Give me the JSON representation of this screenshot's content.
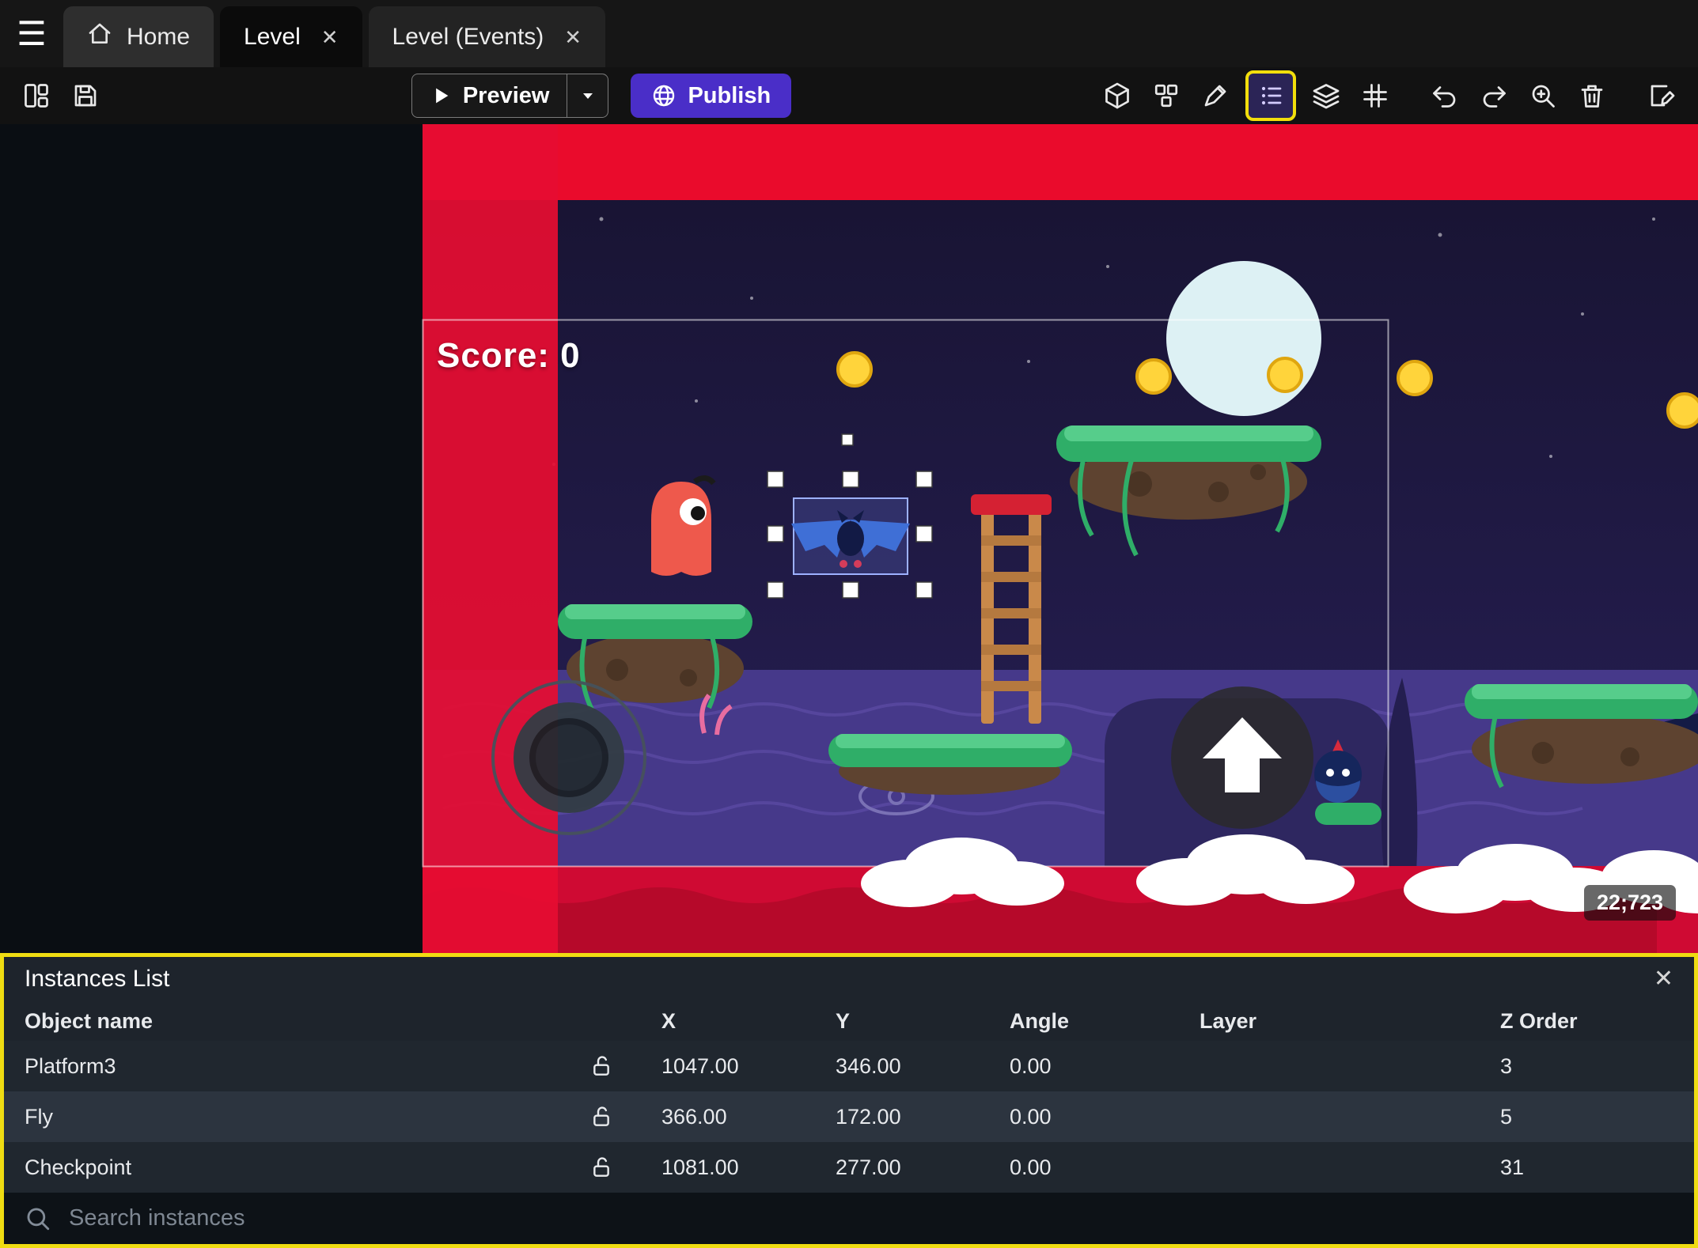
{
  "tab_bar": {
    "menu_glyph": "☰",
    "close_glyph": "✕",
    "tabs": [
      {
        "label": "Home"
      },
      {
        "label": "Level"
      },
      {
        "label": "Level (Events)"
      }
    ]
  },
  "toolbar": {
    "preview_label": "Preview",
    "publish_label": "Publish"
  },
  "scene": {
    "score_text": "Score: 0",
    "position_indicator": "22;723"
  },
  "instances_panel": {
    "title": "Instances List",
    "close_glyph": "✕",
    "columns": {
      "object_name": "Object name",
      "x": "X",
      "y": "Y",
      "angle": "Angle",
      "layer": "Layer",
      "z_order": "Z Order"
    },
    "rows": [
      {
        "name": "Platform3",
        "x": "1047.00",
        "y": "346.00",
        "angle": "0.00",
        "layer": "",
        "z": "3"
      },
      {
        "name": "Fly",
        "x": "366.00",
        "y": "172.00",
        "angle": "0.00",
        "layer": "",
        "z": "5"
      },
      {
        "name": "Checkpoint",
        "x": "1081.00",
        "y": "277.00",
        "angle": "0.00",
        "layer": "",
        "z": "31"
      }
    ],
    "search_placeholder": "Search instances"
  },
  "colors": {
    "highlight": "#f2de0c",
    "publish_button": "#4a2ec8",
    "red_band": "#e60d31",
    "panel_row": "#20272f",
    "panel_row_selected": "#2c343f"
  }
}
